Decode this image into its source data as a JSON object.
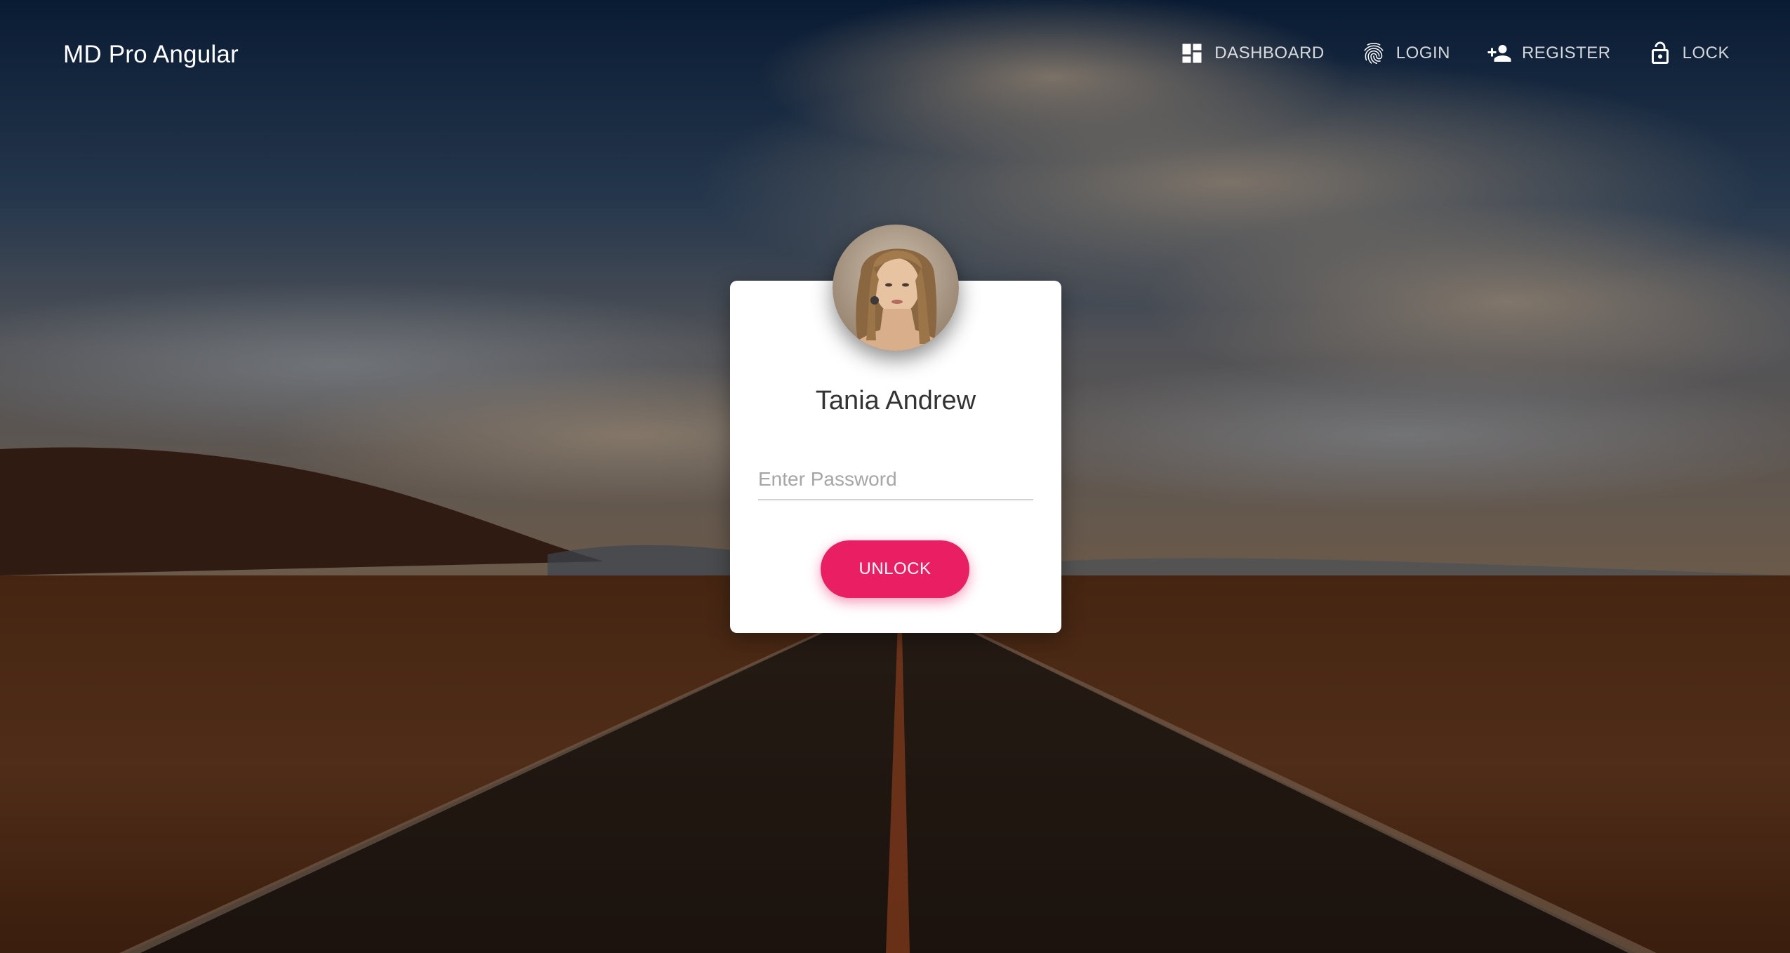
{
  "navbar": {
    "brand": "MD Pro Angular",
    "items": [
      {
        "label": "DASHBOARD",
        "icon": "dashboard-icon"
      },
      {
        "label": "LOGIN",
        "icon": "fingerprint-icon"
      },
      {
        "label": "REGISTER",
        "icon": "person-add-icon"
      },
      {
        "label": "LOCK",
        "icon": "lock-open-icon"
      }
    ]
  },
  "lock_card": {
    "user_name": "Tania Andrew",
    "password_placeholder": "Enter Password",
    "password_value": "",
    "unlock_label": "UNLOCK"
  },
  "colors": {
    "accent": "#e91e63",
    "card_background": "#ffffff",
    "nav_text": "#ffffff"
  }
}
